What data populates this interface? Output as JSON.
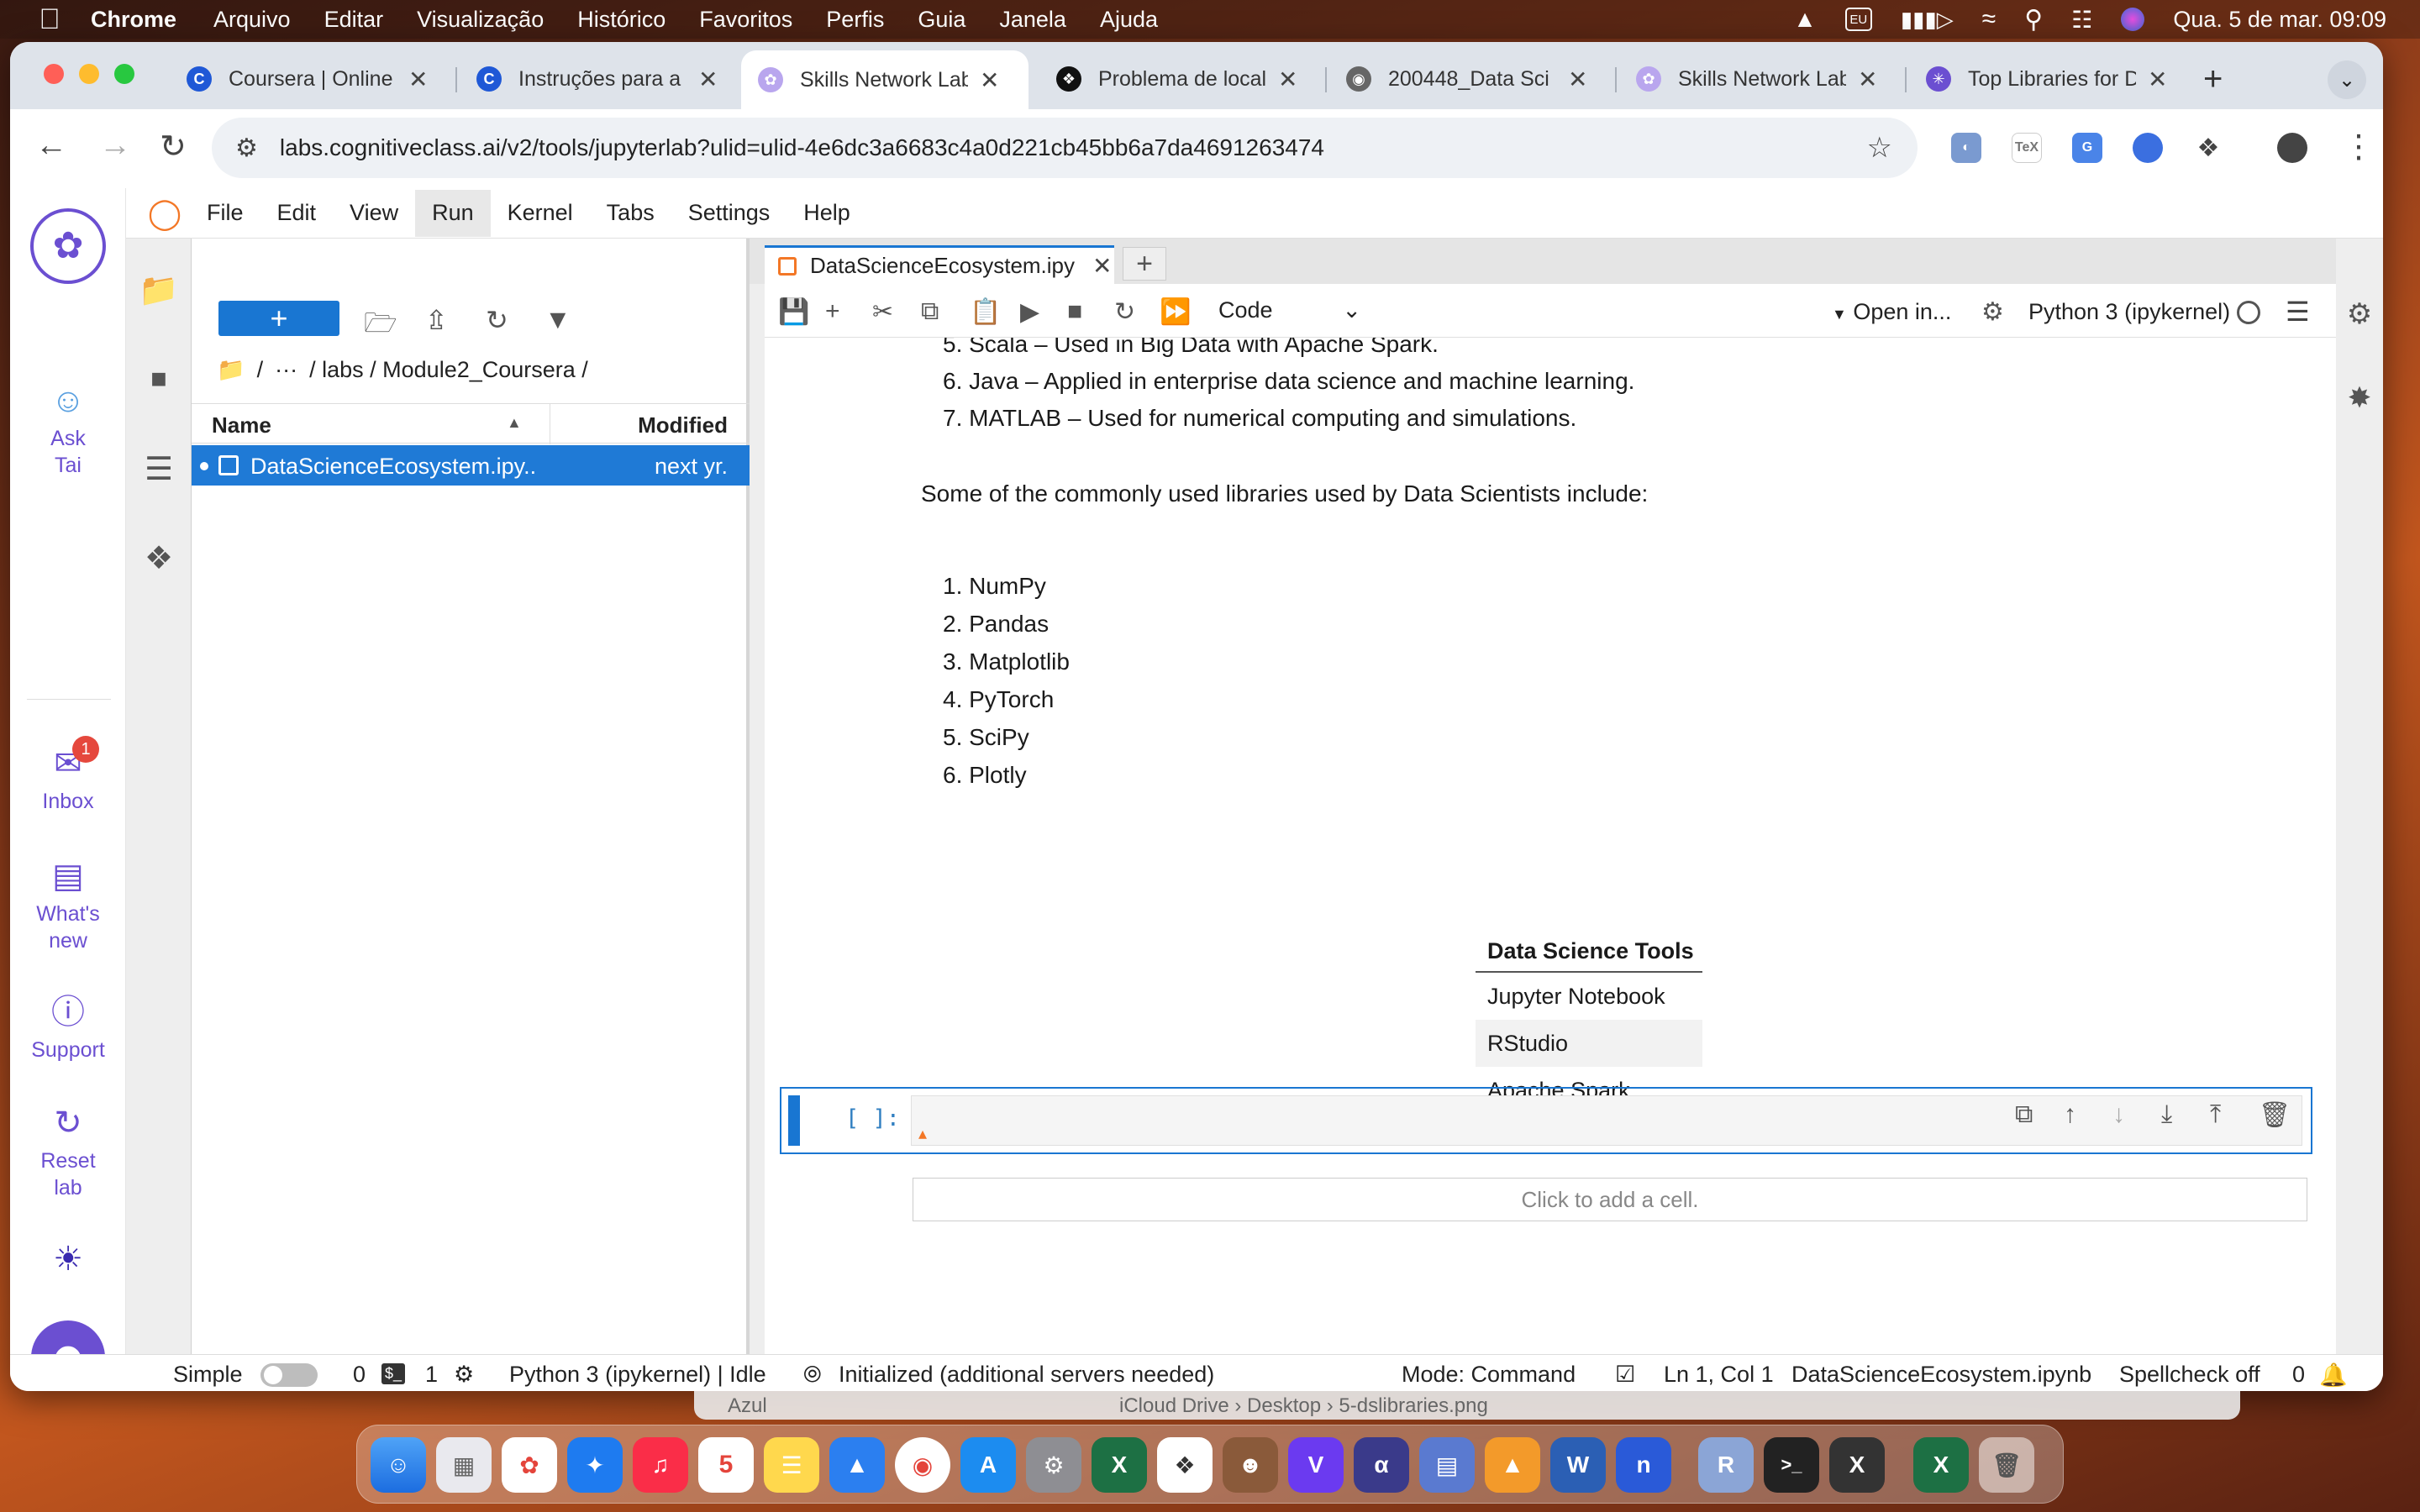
{
  "menubar": {
    "app": "Chrome",
    "items": [
      "Arquivo",
      "Editar",
      "Visualização",
      "Histórico",
      "Favoritos",
      "Perfis",
      "Guia",
      "Janela",
      "Ajuda"
    ],
    "input_badge": "EU",
    "datetime": "Qua. 5 de mar.  09:09"
  },
  "browser": {
    "tabs": [
      {
        "title": "Coursera | Online",
        "icon": "coursera-icon",
        "color": "#1f58d6"
      },
      {
        "title": "Instruções para a",
        "icon": "coursera-icon",
        "color": "#1f58d6"
      },
      {
        "title": "Skills Network Lab",
        "icon": "skills-network-icon",
        "color": "#9b7be0",
        "active": true
      },
      {
        "title": "Problema de local",
        "icon": "openai-icon",
        "color": "#111111"
      },
      {
        "title": "200448_Data Sci",
        "icon": "globe-icon",
        "color": "#555555"
      },
      {
        "title": "Skills Network Lab",
        "icon": "skills-network-icon",
        "color": "#9b7be0"
      },
      {
        "title": "Top Libraries for D",
        "icon": "perplexity-icon",
        "color": "#6b4fd1"
      }
    ],
    "url": "labs.cognitiveclass.ai/v2/tools/jupyterlab?ulid=ulid-4e6dc3a6683c4a0d221cb45bb6a7da4691263474"
  },
  "sn_sidebar": {
    "ask": "Ask Tai",
    "inbox": "Inbox",
    "inbox_count": "1",
    "whats_new": "What's new",
    "support": "Support",
    "reset": "Reset lab"
  },
  "jupyter": {
    "menu": [
      "File",
      "Edit",
      "View",
      "Run",
      "Kernel",
      "Tabs",
      "Settings",
      "Help"
    ],
    "filebrowser": {
      "new_label": "+",
      "path": [
        "/",
        "···",
        "/ labs / Module2_Coursera /"
      ],
      "col_name": "Name",
      "col_modified": "Modified",
      "files": [
        {
          "name": "DataScienceEcosystem.ipy...",
          "modified": "next yr."
        }
      ]
    },
    "doc_tab": "DataScienceEcosystem.ipy",
    "toolbar": {
      "cell_type": "Code",
      "open_in": "Open in...",
      "kernel": "Python 3 (ipykernel)"
    },
    "notebook": {
      "languages_tail": [
        "5.  Scala – Used in Big Data with Apache Spark.",
        "6.  Java – Applied in enterprise data science and machine learning.",
        "7.  MATLAB – Used for numerical computing and simulations."
      ],
      "libraries_intro": "Some of the commonly used libraries used by Data Scientists include:",
      "libraries": [
        "1.  NumPy",
        "2.  Pandas",
        "3.  Matplotlib",
        "4.  PyTorch",
        "5.  SciPy",
        "6.  Plotly"
      ],
      "tools_table": {
        "header": "Data Science Tools",
        "rows": [
          "Jupyter Notebook",
          "RStudio",
          "Apache Spark"
        ]
      },
      "active_prompt": "[ ]:",
      "add_cell": "Click to add a cell."
    },
    "status": {
      "mode_simple": "Simple",
      "terminals": "0",
      "kernels": "1",
      "kernel_status": "Python 3 (ipykernel) | Idle",
      "init": "Initialized (additional servers needed)",
      "mode": "Mode: Command",
      "position": "Ln 1, Col 1",
      "file": "DataScienceEcosystem.ipynb",
      "spellcheck": "Spellcheck off",
      "notifications": "0"
    }
  },
  "finder": {
    "left": "Azul",
    "path": "iCloud Drive  ›   Desktop  ›   5-dslibraries.png"
  }
}
